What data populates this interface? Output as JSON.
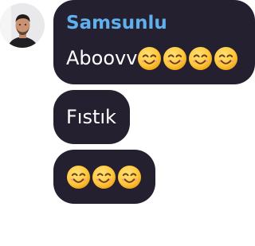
{
  "avatar": {
    "icon": "user-avatar-photo"
  },
  "messages": [
    {
      "sender": "Samsunlu",
      "text": "Aboovv",
      "emoji": [
        "smiling-face-icon",
        "smiling-face-icon",
        "smiling-face-icon",
        "smiling-face-icon"
      ]
    },
    {
      "text": "Fıstık",
      "emoji": []
    },
    {
      "text": "",
      "emoji": [
        "smiling-face-icon",
        "smiling-face-icon",
        "smiling-face-icon"
      ]
    }
  ],
  "colors": {
    "bubble_bg": "#252030",
    "sender_name": "#5fb0ec",
    "message_text": "#ffffff",
    "emoji_face": "#ffc83d"
  }
}
